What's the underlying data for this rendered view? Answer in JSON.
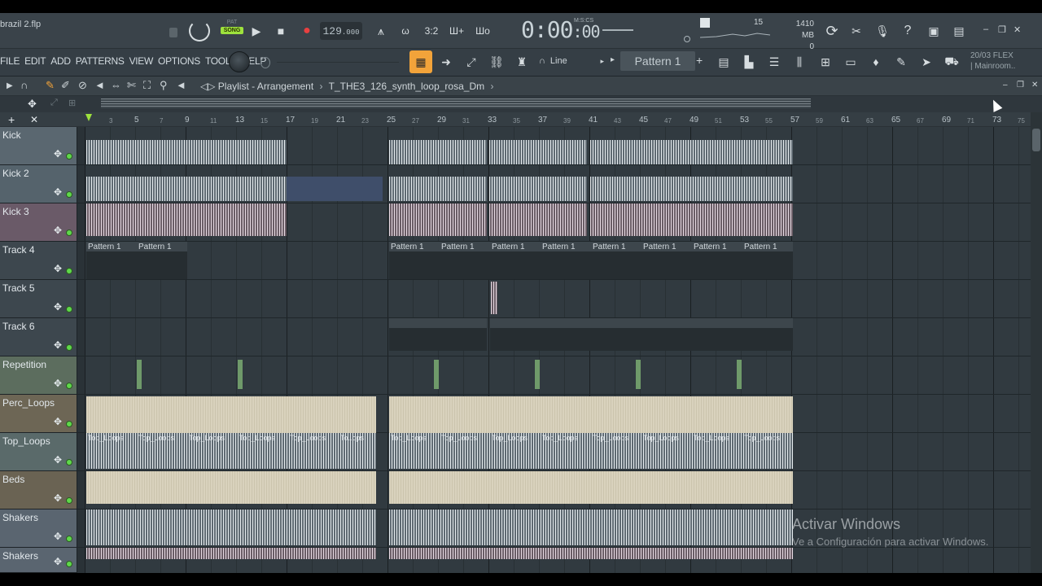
{
  "window": {
    "filename": "brazil 2.flp",
    "minimize": "–",
    "restore": "❐",
    "close": "✕"
  },
  "transport": {
    "pat_label": "PAT",
    "song_label": "SONG",
    "tempo_main": "129",
    "tempo_frac": ".000",
    "time_main": "0:00",
    "time_frac": ":00",
    "time_unit": "M:S:CS",
    "cpu_value": "15",
    "memory": "1410 MB",
    "polyphony": "0"
  },
  "menu": [
    "FILE",
    "EDIT",
    "ADD",
    "PATTERNS",
    "VIEW",
    "OPTIONS",
    "TOOLS",
    "HELP"
  ],
  "toolbar2": {
    "snap_label": "Line",
    "pattern_label": "Pattern 1",
    "add_pattern": "+",
    "flex_line1": "20/03  FLEX",
    "flex_line2": "| Mainroom.."
  },
  "playlist": {
    "title": "Playlist - Arrangement",
    "separator": "›",
    "clip_name": "T_THE3_126_synth_loop_rosa_Dm",
    "end_arrow": "›"
  },
  "ruler": {
    "major": [
      "5",
      "9",
      "13",
      "17",
      "21",
      "25",
      "29",
      "33",
      "37",
      "41",
      "45",
      "49",
      "53",
      "57",
      "61",
      "65",
      "69",
      "73"
    ],
    "minor": [
      "3",
      "7",
      "11",
      "15",
      "19",
      "23",
      "27",
      "31",
      "35",
      "39",
      "43",
      "47",
      "51",
      "55",
      "59",
      "63",
      "67",
      "71",
      "75"
    ]
  },
  "tracks": [
    {
      "name": "Kick"
    },
    {
      "name": "Kick 2"
    },
    {
      "name": "Kick 3"
    },
    {
      "name": "Track 4"
    },
    {
      "name": "Track 5"
    },
    {
      "name": "Track 6"
    },
    {
      "name": "Repetition"
    },
    {
      "name": "Perc_Loops"
    },
    {
      "name": "Top_Loops"
    },
    {
      "name": "Beds"
    },
    {
      "name": "Shakers"
    },
    {
      "name": "Shakers"
    }
  ],
  "clip_labels": {
    "pattern1": "Pattern 1",
    "top_loops": "Top_Loops",
    "top_loops_short": "To..ops"
  },
  "watermark": {
    "line1": "Activar Windows",
    "line2": "Ve a Configuración para activar Windows."
  },
  "colors": {
    "accent_orange": "#f2a33a",
    "song_green": "#9ee23d",
    "led_green": "#5fd84a"
  }
}
